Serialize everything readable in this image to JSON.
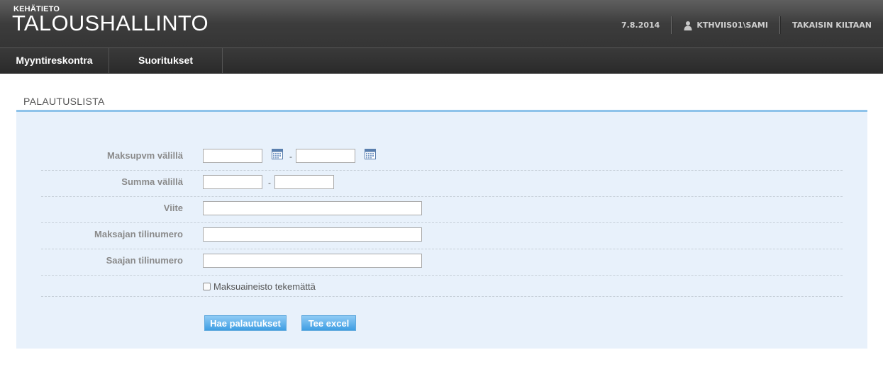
{
  "header": {
    "brand_small": "KEHÄTIETO",
    "brand_title": "TALOUSHALLINTO",
    "date": "7.8.2014",
    "user": "KTHVIIS01\\SAMI",
    "back_link": "TAKAISIN KILTAAN"
  },
  "nav": {
    "items": [
      {
        "label": "Myyntireskontra"
      },
      {
        "label": "Suoritukset"
      }
    ]
  },
  "section": {
    "title": "PALAUTUSLISTA"
  },
  "form": {
    "maksupvm_label": "Maksupvm välillä",
    "summa_label": "Summa välillä",
    "viite_label": "Viite",
    "maksajan_label": "Maksajan tilinumero",
    "saajan_label": "Saajan tilinumero",
    "range_separator": "-",
    "maksuaineisto_label": "Maksuaineisto tekemättä",
    "fields": {
      "maksupvm_from": "",
      "maksupvm_to": "",
      "summa_from": "",
      "summa_to": "",
      "viite": "",
      "maksajan_tilinumero": "",
      "saajan_tilinumero": ""
    },
    "maksuaineisto_checked": false
  },
  "buttons": {
    "search_label": "Hae palautukset",
    "excel_label": "Tee excel"
  },
  "icons": {
    "user": "user-icon",
    "calendar": "calendar-icon"
  },
  "colors": {
    "accent": "#8ec3ea",
    "panel_bg": "#e8f1fb",
    "button": "#3f9ee3"
  }
}
